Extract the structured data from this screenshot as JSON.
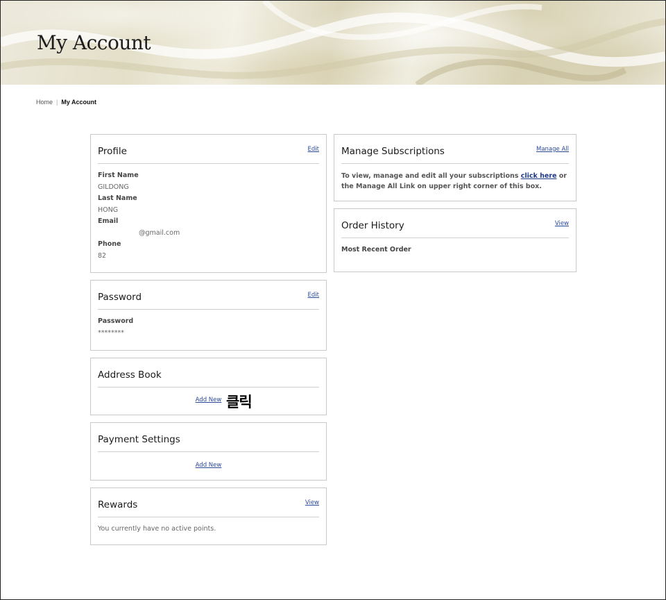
{
  "hero": {
    "title": "My Account"
  },
  "breadcrumb": {
    "home": "Home",
    "separator": "|",
    "current": "My Account"
  },
  "profile": {
    "title": "Profile",
    "edit_label": "Edit",
    "first_name_label": "First Name",
    "first_name": "GILDONG",
    "last_name_label": "Last Name",
    "last_name": "HONG",
    "email_label": "Email",
    "email": "@gmail.com",
    "phone_label": "Phone",
    "phone": "82"
  },
  "password": {
    "title": "Password",
    "edit_label": "Edit",
    "field_label": "Password",
    "value": "********"
  },
  "address_book": {
    "title": "Address Book",
    "add_label": "Add New",
    "annotation": "클릭"
  },
  "payment_settings": {
    "title": "Payment Settings",
    "add_label": "Add New"
  },
  "rewards": {
    "title": "Rewards",
    "view_label": "View",
    "message": "You currently have no active points."
  },
  "subscriptions": {
    "title": "Manage Subscriptions",
    "manage_label": "Manage All",
    "text_before": "To view, manage and edit all your subscriptions ",
    "link_text": "click here",
    "text_after": " or the Manage All Link on upper right corner of this box."
  },
  "order_history": {
    "title": "Order History",
    "view_label": "View",
    "most_recent_label": "Most Recent Order"
  },
  "colors": {
    "link": "#2b4a9a",
    "border": "#c9c9c9",
    "text": "#333333"
  }
}
